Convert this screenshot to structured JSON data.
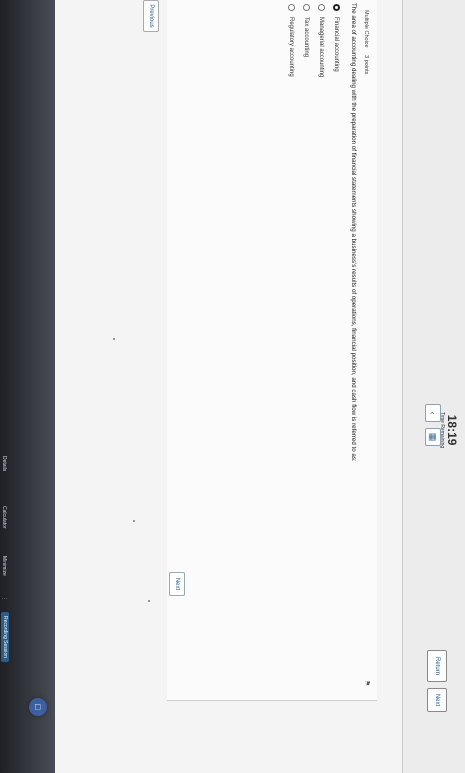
{
  "header": {
    "timer": "18:19",
    "timer_label": "Time Remaining",
    "back_icon": "chevron-left-icon",
    "calc_icon": "calculator-icon",
    "return_label": "Return",
    "next_label": "Next"
  },
  "question": {
    "type_label": "Multiple Choice",
    "points": "3 points",
    "text": "The area of accounting dealing with the preparation of financial statements showing a business's results of operations, financial position, and cash flow is referred to as:",
    "options": [
      {
        "label": "Financial accounting",
        "selected": true
      },
      {
        "label": "Managerial accounting",
        "selected": false
      },
      {
        "label": "Tax accounting",
        "selected": false
      },
      {
        "label": "Regulatory accounting",
        "selected": false
      }
    ],
    "flag_icon": "flag-icon"
  },
  "nav": {
    "next_label": "Next",
    "previous_label": "Previous"
  },
  "taskbar": {
    "details": "Details",
    "calculator": "Calculator",
    "minimize": "Minimize",
    "recording": "Recording Session"
  },
  "colors": {
    "accent": "#2a5d8a",
    "taskbar": "#1e2026",
    "chat": "#3b5fa0"
  }
}
